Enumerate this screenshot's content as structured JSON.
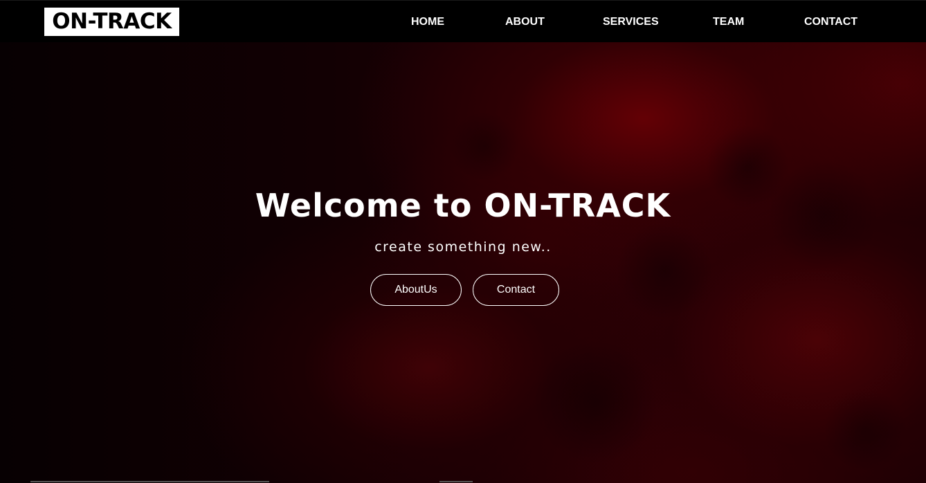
{
  "header": {
    "logo_text": "ON-TRACK",
    "nav": [
      {
        "label": "HOME"
      },
      {
        "label": "ABOUT"
      },
      {
        "label": "SERVICES"
      },
      {
        "label": "TEAM"
      },
      {
        "label": "CONTACT"
      }
    ]
  },
  "hero": {
    "title": "Welcome to ON-TRACK",
    "subtitle": "create something new..",
    "buttons": {
      "about_label": "AboutUs",
      "contact_label": "Contact"
    }
  },
  "colors": {
    "navbar_bg": "#000000",
    "hero_accent": "#6e0005",
    "text": "#ffffff"
  }
}
